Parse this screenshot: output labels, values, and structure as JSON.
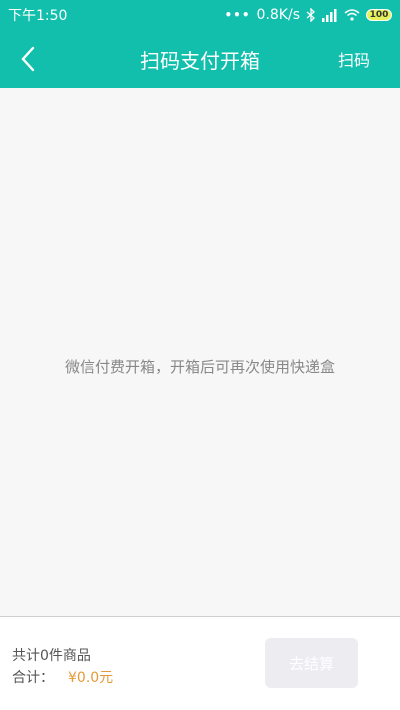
{
  "status_bar": {
    "time": "下午1:50",
    "dots": "•••",
    "network_speed": "0.8K/s",
    "battery": "100",
    "colors": {
      "bar": "#12bfad",
      "battery": "#e6f25a"
    }
  },
  "nav": {
    "title": "扫码支付开箱",
    "scan_label": "扫码",
    "back_icon": "chevron-left-icon"
  },
  "content": {
    "empty_message": "微信付费开箱，开箱后可再次使用快递盒"
  },
  "footer": {
    "count_text": "共计0件商品",
    "total_label": "合计：",
    "total_amount": "¥0.0元",
    "checkout_label": "去结算",
    "checkout_enabled": false,
    "colors": {
      "amount": "#e69a3a",
      "button": "#ececf1"
    }
  }
}
